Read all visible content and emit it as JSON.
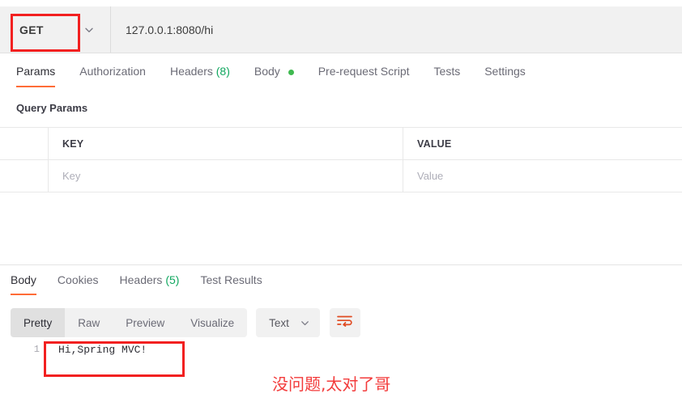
{
  "request_bar": {
    "method": "GET",
    "method_caret_icon": "chevron-down-icon",
    "url": "127.0.0.1:8080/hi"
  },
  "request_tabs": [
    {
      "label": "Params",
      "active": true
    },
    {
      "label": "Authorization",
      "active": false
    },
    {
      "label": "Headers",
      "count": "(8)",
      "active": false
    },
    {
      "label": "Body",
      "dot": true,
      "active": false
    },
    {
      "label": "Pre-request Script",
      "active": false
    },
    {
      "label": "Tests",
      "active": false
    },
    {
      "label": "Settings",
      "active": false
    }
  ],
  "query_params": {
    "section_title": "Query Params",
    "headers": {
      "checkbox": "",
      "key": "KEY",
      "value": "VALUE"
    },
    "rows": [
      {
        "key_placeholder": "Key",
        "value_placeholder": "Value"
      }
    ]
  },
  "response_tabs": [
    {
      "label": "Body",
      "active": true
    },
    {
      "label": "Cookies",
      "active": false
    },
    {
      "label": "Headers",
      "count": "(5)",
      "active": false
    },
    {
      "label": "Test Results",
      "active": false
    }
  ],
  "view_modes": [
    {
      "label": "Pretty",
      "active": true
    },
    {
      "label": "Raw",
      "active": false
    },
    {
      "label": "Preview",
      "active": false
    },
    {
      "label": "Visualize",
      "active": false
    }
  ],
  "content_type": {
    "label": "Text",
    "caret_icon": "chevron-down-icon"
  },
  "wrap_lines": {
    "icon": "wrap-lines-icon"
  },
  "response_body": {
    "line_number": "1",
    "text": "Hi,Spring MVC!"
  },
  "annotations": {
    "chinese_note": "没问题,太对了哥",
    "highlight_color": "#f22020"
  },
  "colors": {
    "accent_orange": "#ff6c37",
    "count_green": "#10a75f",
    "dot_green": "#3fb950",
    "annotation_red": "#f33b3b",
    "toolbar_bg": "#f1f1f1"
  }
}
